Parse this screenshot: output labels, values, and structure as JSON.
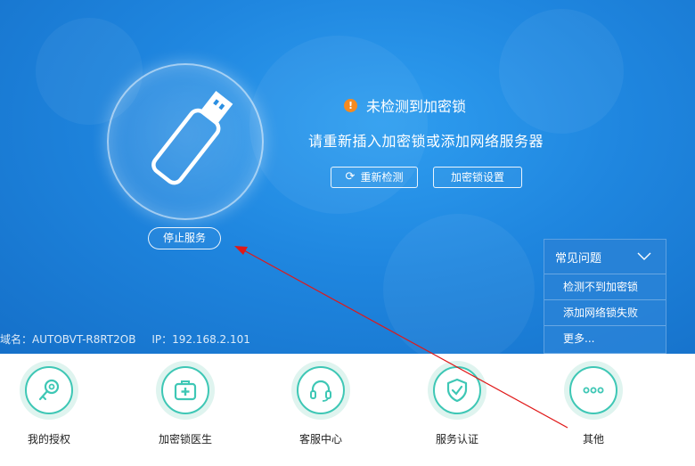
{
  "hero": {
    "stop_service_label": "停止服务",
    "status_text": "未检测到加密锁",
    "status_icon": "warning-icon",
    "hint_text": "请重新插入加密锁或添加网络服务器",
    "recheck_label": "重新检测",
    "lock_settings_label": "加密锁设置",
    "device_name": "域名：AUTOBVT-R8RT2OB",
    "device_ip": "IP：192.168.2.101",
    "colors": {
      "background": "#1f86df",
      "warning": "#f58a1f"
    }
  },
  "faq": {
    "title": "常见问题",
    "items": [
      "检测不到加密锁",
      "添加网络锁失败",
      "更多..."
    ]
  },
  "toolbar": {
    "accent": "#3ec7b5",
    "items": [
      {
        "label": "我的授权",
        "icon": "key-icon"
      },
      {
        "label": "加密锁医生",
        "icon": "first-aid-kit-icon"
      },
      {
        "label": "客服中心",
        "icon": "headset-icon"
      },
      {
        "label": "服务认证",
        "icon": "shield-check-icon"
      },
      {
        "label": "其他",
        "icon": "more-dots-icon"
      }
    ]
  }
}
